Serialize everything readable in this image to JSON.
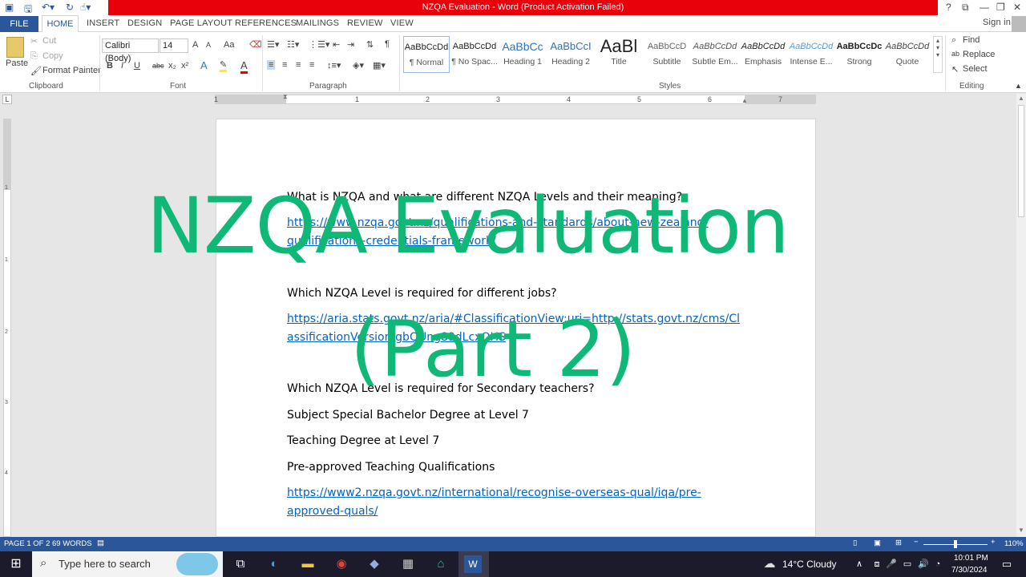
{
  "window": {
    "title": "NZQA Evaluation  -  Word (Product Activation Failed)",
    "help": "?",
    "sign_in": "Sign in"
  },
  "tabs": [
    "FILE",
    "HOME",
    "INSERT",
    "DESIGN",
    "PAGE LAYOUT",
    "REFERENCES",
    "MAILINGS",
    "REVIEW",
    "VIEW"
  ],
  "clipboard": {
    "paste": "Paste",
    "cut": "Cut",
    "copy": "Copy",
    "format_painter": "Format Painter",
    "label": "Clipboard"
  },
  "font": {
    "name": "Calibri (Body)",
    "size": "14",
    "label": "Font",
    "grow": "A",
    "shrink": "A",
    "case": "Aa",
    "bold": "B",
    "italic": "I",
    "underline": "U",
    "strike": "abc",
    "sub": "x₂",
    "sup": "x²"
  },
  "paragraph": {
    "label": "Paragraph",
    "pilcrow": "¶"
  },
  "styles": {
    "label": "Styles",
    "items": [
      {
        "sample": "AaBbCcDd",
        "name": "¶ Normal"
      },
      {
        "sample": "AaBbCcDd",
        "name": "¶ No Spac..."
      },
      {
        "sample": "AaBbCc",
        "name": "Heading 1"
      },
      {
        "sample": "AaBbCcI",
        "name": "Heading 2"
      },
      {
        "sample": "AaBl",
        "name": "Title"
      },
      {
        "sample": "AaBbCcD",
        "name": "Subtitle"
      },
      {
        "sample": "AaBbCcDd",
        "name": "Subtle Em..."
      },
      {
        "sample": "AaBbCcDd",
        "name": "Emphasis"
      },
      {
        "sample": "AaBbCcDd",
        "name": "Intense E..."
      },
      {
        "sample": "AaBbCcDc",
        "name": "Strong"
      },
      {
        "sample": "AaBbCcDd",
        "name": "Quote"
      }
    ]
  },
  "editing": {
    "find": "Find",
    "replace": "Replace",
    "select": "Select",
    "label": "Editing"
  },
  "ruler": {
    "h_numbers": [
      "1",
      "1",
      "2",
      "3",
      "4",
      "5",
      "6",
      "7"
    ],
    "v_numbers": [
      "1",
      "1",
      "2",
      "3",
      "4"
    ]
  },
  "document": {
    "q1": "What is NZQA and what are different NZQA Levels and their meaning?",
    "link1_a": "https://www.nzqa.govt.nz/qualifications-and-standards/about-new-zealand-",
    "link1_b": "qualifications-credentials-framework/",
    "q2": "Which NZQA Level is required for different jobs?",
    "link2_a": "https://aria.stats.govt.nz/aria/#ClassificationView:uri=http://stats.govt.nz/cms/Cl",
    "link2_b": "assificationVersion/gbQUng89dLcxOHS",
    "q3": "Which NZQA Level is required for Secondary teachers?",
    "line4": "Subject Special Bachelor Degree at Level 7",
    "line5": "Teaching Degree at Level 7",
    "line6": "Pre-approved Teaching Qualifications",
    "link3_a": "https://www2.nzqa.govt.nz/international/recognise-overseas-qual/iqa/pre-",
    "link3_b": "approved-quals/"
  },
  "overlay": {
    "line1": "NZQA Evaluation",
    "line2": "(Part 2)",
    "color": "#10b877"
  },
  "status": {
    "page": "PAGE 1 OF 2",
    "words": "69 WORDS",
    "zoom": "110%"
  },
  "taskbar": {
    "search_placeholder": "Type here to search",
    "weather": "14°C  Cloudy",
    "time": "10:01 PM",
    "date": "7/30/2024"
  }
}
